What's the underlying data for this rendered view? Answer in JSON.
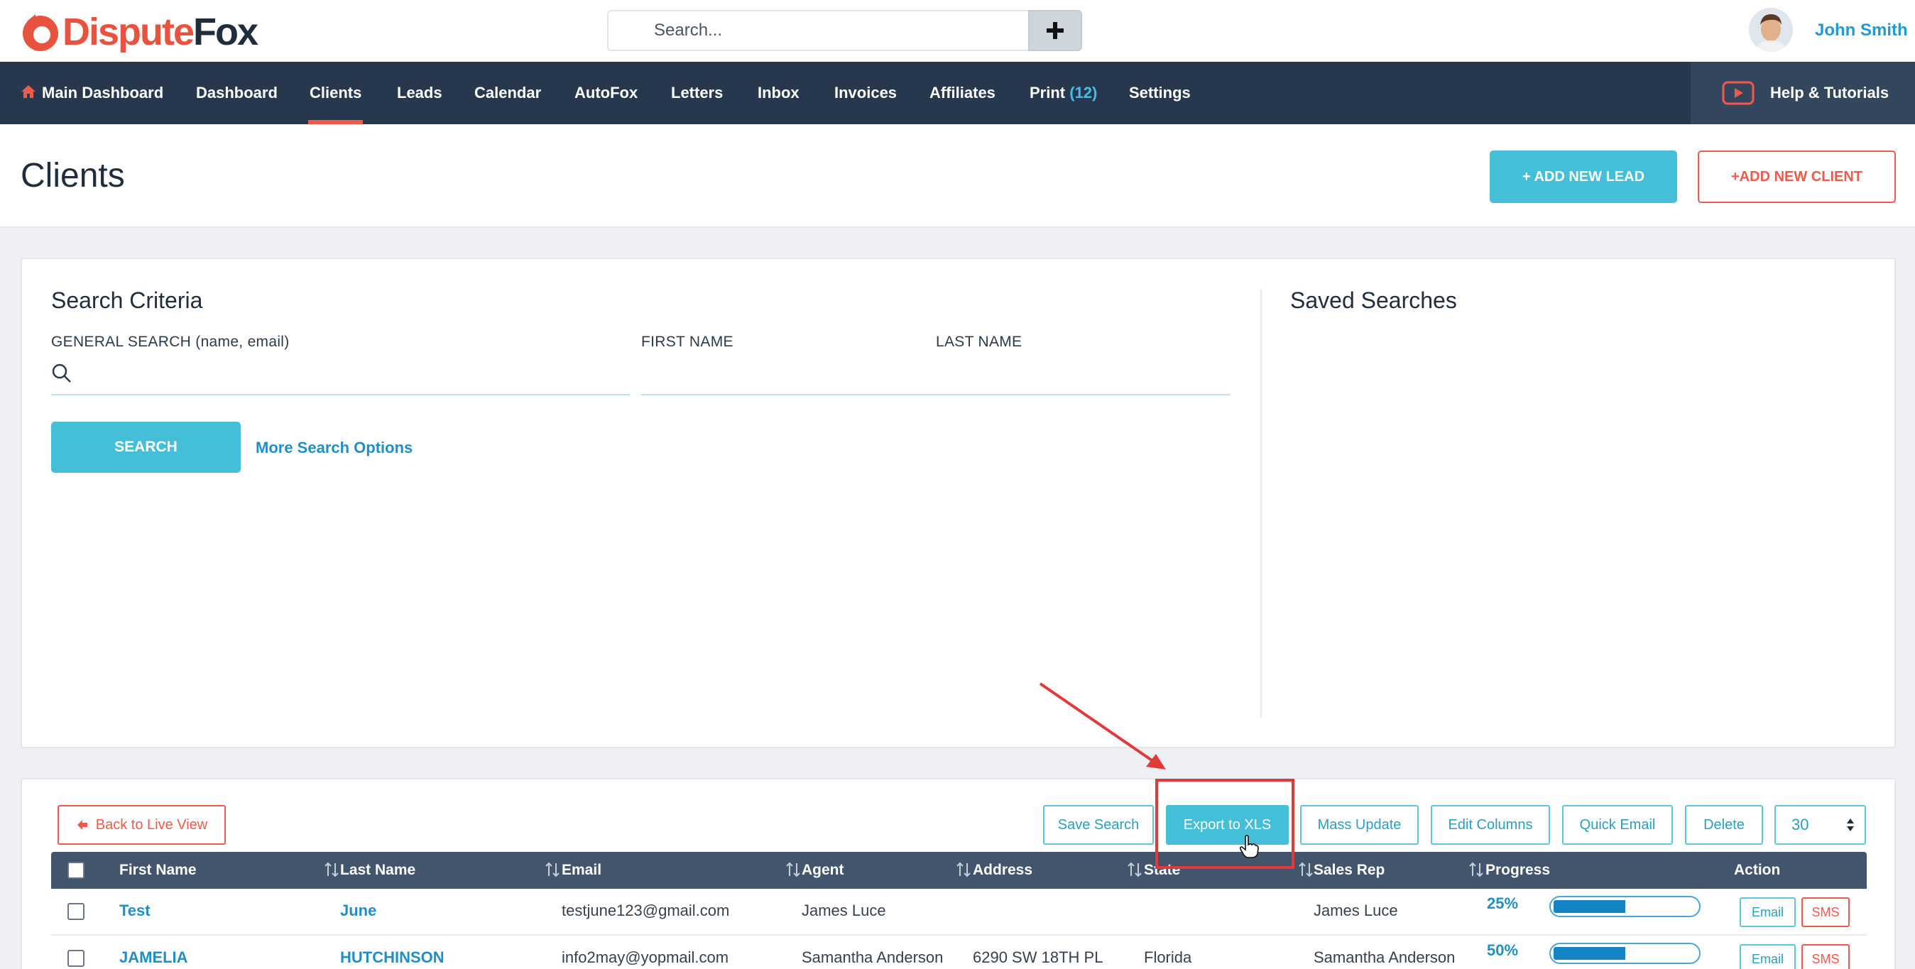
{
  "app": {
    "brand_part1": "Dispute",
    "brand_part2": "Fox",
    "accent": "#ef5a4a",
    "nav_bg": "#27374d",
    "teal": "#45bfd7"
  },
  "header": {
    "search_placeholder": "Search...",
    "plus_icon": "plus-icon",
    "user_name": "John Smith"
  },
  "nav": {
    "items": [
      {
        "label": "Main Dashboard",
        "icon": "home-icon"
      },
      {
        "label": "Dashboard"
      },
      {
        "label": "Clients",
        "active": true
      },
      {
        "label": "Leads"
      },
      {
        "label": "Calendar"
      },
      {
        "label": "AutoFox"
      },
      {
        "label": "Letters"
      },
      {
        "label": "Inbox"
      },
      {
        "label": "Invoices"
      },
      {
        "label": "Affiliates"
      },
      {
        "label": "Print",
        "count": "(12)"
      },
      {
        "label": "Settings"
      }
    ],
    "help_label": "Help & Tutorials",
    "help_icon": "youtube-play-icon"
  },
  "page": {
    "title": "Clients",
    "add_lead": "+ ADD NEW LEAD",
    "add_client": "+ADD NEW CLIENT"
  },
  "search": {
    "title": "Search Criteria",
    "general_label": "GENERAL SEARCH (name, email)",
    "first_name_label": "FIRST NAME",
    "last_name_label": "LAST NAME",
    "search_button": "SEARCH",
    "more_options": "More Search Options",
    "saved_title": "Saved Searches"
  },
  "toolbar": {
    "back": "Back to Live View",
    "save_search": "Save Search",
    "export": "Export to XLS",
    "mass_update": "Mass Update",
    "edit_columns": "Edit Columns",
    "quick_email": "Quick Email",
    "delete": "Delete",
    "per_page": "30"
  },
  "table": {
    "columns": [
      "First Name",
      "Last Name",
      "Email",
      "Agent",
      "Address",
      "State",
      "Sales Rep",
      "Progress",
      "Action"
    ],
    "rows": [
      {
        "first": "Test",
        "last": "June",
        "email": "testjune123@gmail.com",
        "agent": "James Luce",
        "address": "",
        "state": "",
        "sales_rep": "James Luce",
        "progress_label": "25%",
        "progress": 0.5
      },
      {
        "first": "JAMELIA",
        "last": "HUTCHINSON",
        "email": "info2may@yopmail.com",
        "agent": "Samantha Anderson",
        "address": "6290 SW 18TH PL",
        "state": "Florida",
        "sales_rep": "Samantha Anderson",
        "progress_label": "50%",
        "progress": 0.5
      }
    ],
    "email_btn": "Email",
    "sms_btn": "SMS"
  }
}
